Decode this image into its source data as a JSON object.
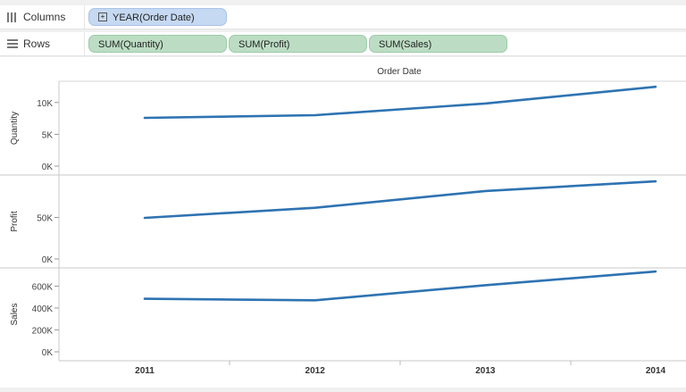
{
  "shelves": {
    "columns": {
      "label": "Columns",
      "pills": [
        {
          "text": "YEAR(Order Date)",
          "color": "#c6d9f2"
        }
      ]
    },
    "rows": {
      "label": "Rows",
      "pills": [
        {
          "text": "SUM(Quantity)",
          "color": "#bcddc4"
        },
        {
          "text": "SUM(Profit)",
          "color": "#bcddc4"
        },
        {
          "text": "SUM(Sales)",
          "color": "#bcddc4"
        }
      ]
    }
  },
  "chart_data": {
    "type": "line",
    "header": "Order Date",
    "x": [
      "2011",
      "2012",
      "2013",
      "2014"
    ],
    "line_color": "#2e73b2",
    "panels": [
      {
        "name": "Quantity",
        "ylabel": "Quantity",
        "ylim": [
          0,
          12500
        ],
        "ticks": [
          0,
          5000,
          10000
        ],
        "tick_labels": [
          "0K",
          "5K",
          "10K"
        ],
        "values": [
          7580,
          8000,
          9840,
          12470
        ]
      },
      {
        "name": "Profit",
        "ylabel": "Profit",
        "ylim": [
          0,
          100000
        ],
        "ticks": [
          0,
          50000
        ],
        "tick_labels": [
          "0K",
          "50K"
        ],
        "values": [
          49500,
          61600,
          81800,
          93400
        ]
      },
      {
        "name": "Sales",
        "ylabel": "Sales",
        "ylim": [
          0,
          750000
        ],
        "ticks": [
          0,
          200000,
          400000,
          600000
        ],
        "tick_labels": [
          "0K",
          "200K",
          "400K",
          "600K"
        ],
        "values": [
          484000,
          470000,
          608000,
          733000
        ]
      }
    ]
  }
}
